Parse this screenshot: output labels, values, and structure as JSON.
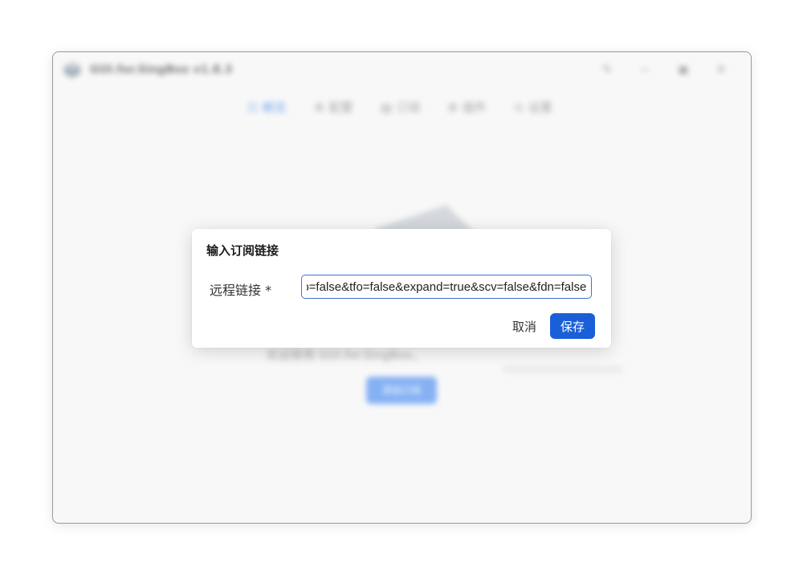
{
  "window": {
    "title": "GUI.for.SingBox v1.8.3",
    "controls": {
      "pin_icon": "pin-icon",
      "minimize_icon": "minimize-icon",
      "maximize_icon": "maximize-icon",
      "close_icon": "close-icon"
    }
  },
  "nav": {
    "items": [
      {
        "icon": "overview-icon",
        "glyph": "☷",
        "label": "概览",
        "active": true
      },
      {
        "icon": "profiles-icon",
        "glyph": "⚙",
        "label": "配置",
        "active": false
      },
      {
        "icon": "subscriptions-icon",
        "glyph": "▤",
        "label": "订阅",
        "active": false
      },
      {
        "icon": "plugins-icon",
        "glyph": "⚙",
        "label": "插件",
        "active": false
      },
      {
        "icon": "settings-icon",
        "glyph": "⊙",
        "label": "设置",
        "active": false
      }
    ]
  },
  "main": {
    "welcome_text": "欢迎使用 GUI.for.SingBox，    ",
    "new_subscription_button": "添加订阅"
  },
  "dialog": {
    "title": "输入订阅链接",
    "field_label": "远程链接 *",
    "url_value": "lp=false&tfo=false&expand=true&scv=false&fdn=false",
    "cancel_label": "取消",
    "save_label": "保存"
  },
  "colors": {
    "accent": "#1a5fd8",
    "input_border": "#3d73d6",
    "nav_active": "#4a8ef0"
  }
}
